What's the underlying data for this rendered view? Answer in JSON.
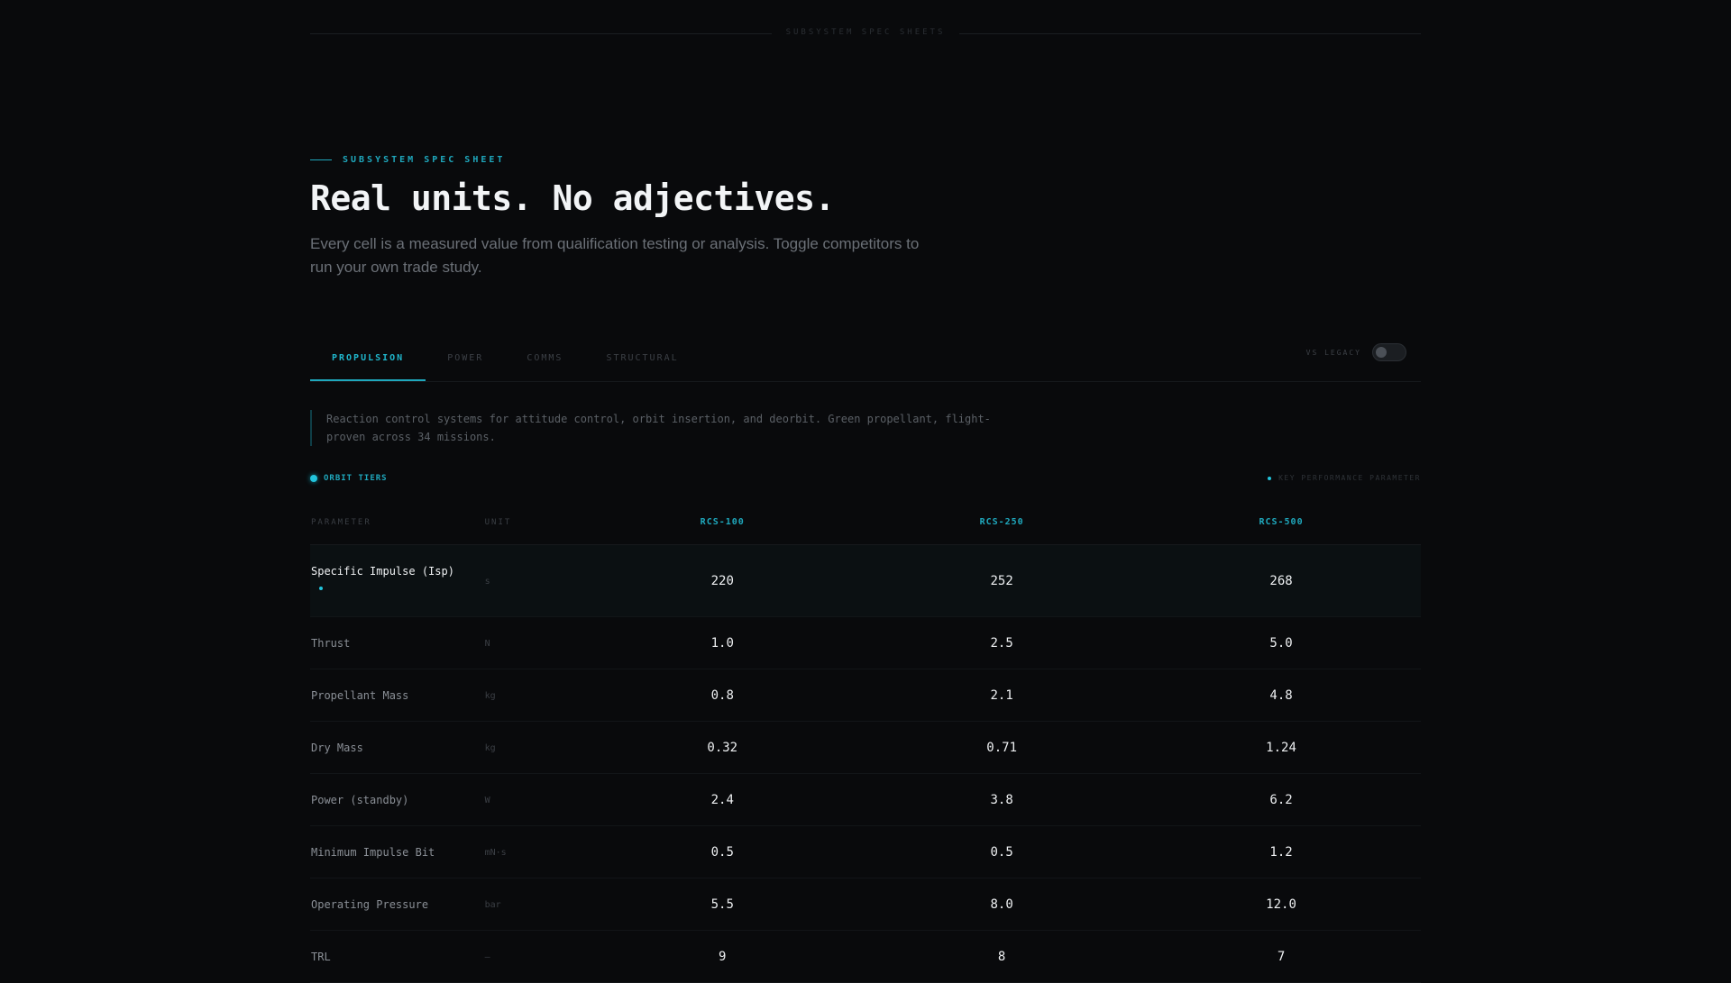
{
  "top_bar": {
    "label": "SUBSYSTEM SPEC SHEETS"
  },
  "hero": {
    "eyebrow": "SUBSYSTEM SPEC SHEET",
    "title": "Real units. No adjectives.",
    "lede": "Every cell is a measured value from qualification testing or analysis. Toggle competitors to run your own trade study."
  },
  "tabs": [
    {
      "label": "PROPULSION",
      "active": true
    },
    {
      "label": "POWER",
      "active": false
    },
    {
      "label": "COMMS",
      "active": false
    },
    {
      "label": "STRUCTURAL",
      "active": false
    }
  ],
  "toggle": {
    "label": "VS LEGACY",
    "on": false
  },
  "description": "Reaction control systems for attitude control, orbit insertion, and deorbit. Green propellant, flight-proven across 34 missions.",
  "legend": {
    "tiers_label": "ORBIT TIERS",
    "kpp_label": "KEY PERFORMANCE PARAMETER"
  },
  "table": {
    "headers": {
      "parameter": "PARAMETER",
      "unit": "UNIT"
    },
    "models": [
      "RCS-100",
      "RCS-250",
      "RCS-500"
    ],
    "rows": [
      {
        "parameter": "Specific Impulse (Isp)",
        "unit": "s",
        "values": [
          "220",
          "252",
          "268"
        ],
        "kpp": true
      },
      {
        "parameter": "Thrust",
        "unit": "N",
        "values": [
          "1.0",
          "2.5",
          "5.0"
        ],
        "kpp": false
      },
      {
        "parameter": "Propellant Mass",
        "unit": "kg",
        "values": [
          "0.8",
          "2.1",
          "4.8"
        ],
        "kpp": false
      },
      {
        "parameter": "Dry Mass",
        "unit": "kg",
        "values": [
          "0.32",
          "0.71",
          "1.24"
        ],
        "kpp": false
      },
      {
        "parameter": "Power (standby)",
        "unit": "W",
        "values": [
          "2.4",
          "3.8",
          "6.2"
        ],
        "kpp": false
      },
      {
        "parameter": "Minimum Impulse Bit",
        "unit": "mN·s",
        "values": [
          "0.5",
          "0.5",
          "1.2"
        ],
        "kpp": false
      },
      {
        "parameter": "Operating Pressure",
        "unit": "bar",
        "values": [
          "5.5",
          "8.0",
          "12.0"
        ],
        "kpp": false
      },
      {
        "parameter": "TRL",
        "unit": "—",
        "values": [
          "9",
          "8",
          "7"
        ],
        "kpp": false
      }
    ]
  }
}
